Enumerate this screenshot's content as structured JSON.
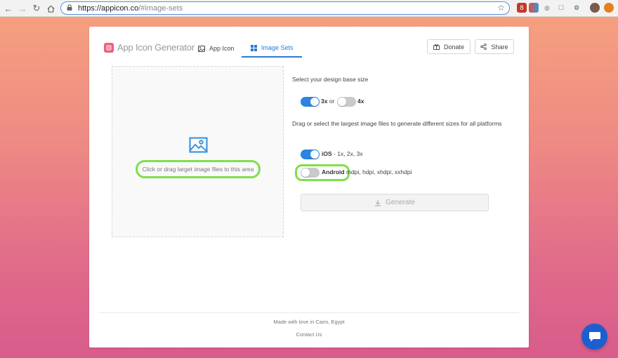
{
  "browser": {
    "url_host": "https://appicon.co",
    "url_path": "/#image-sets"
  },
  "header": {
    "logo_text": "App Icon Generator",
    "tabs": [
      {
        "label": "App Icon",
        "active": false
      },
      {
        "label": "Image Sets",
        "active": true
      }
    ],
    "donate_label": "Donate",
    "share_label": "Share"
  },
  "dropzone": {
    "text": "Click or drag larget image files to this area"
  },
  "options": {
    "base_size_label": "Select your design base size",
    "size_3x": {
      "label": "3x",
      "on": true
    },
    "or_text": "or",
    "size_4x": {
      "label": "4x",
      "on": false
    },
    "platforms_label": "Drag or select the largest image files to generate different sizes for all platforms",
    "ios": {
      "label": "iOS",
      "detail": " - 1x, 2x, 3x",
      "on": true
    },
    "android": {
      "label": "Android",
      "detail": " mdpi, hdpi, xhdpi, xxhdpi",
      "on": false
    },
    "generate_label": "Generate"
  },
  "footer": {
    "made_with": "Made with love in Cairo, Egypt",
    "contact": "Contact Us"
  },
  "colors": {
    "accent": "#2b84e0",
    "highlight": "#7de04a",
    "brand": "#ee5f7d"
  }
}
